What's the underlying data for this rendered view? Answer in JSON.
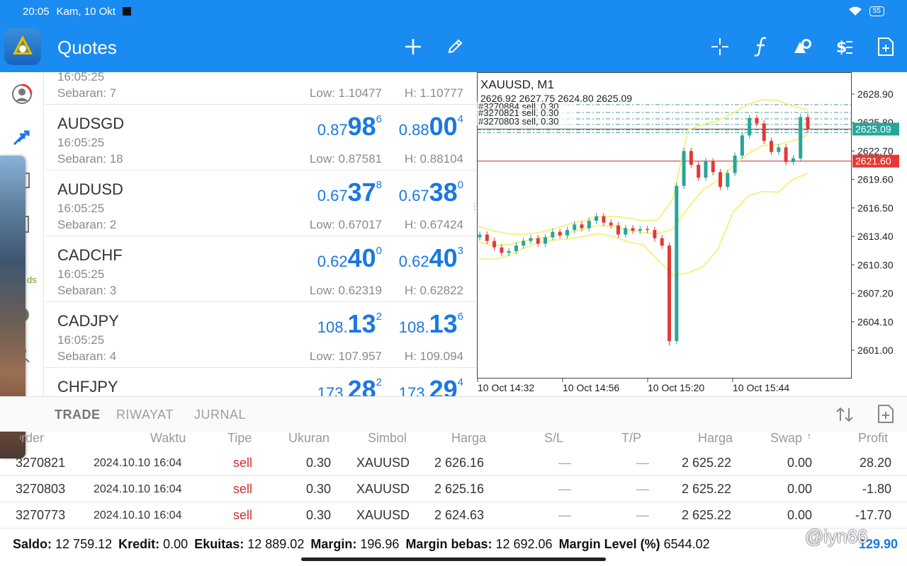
{
  "status": {
    "time": "20:05",
    "date": "Kam, 10 Okt",
    "battery": "55"
  },
  "header": {
    "title": "Quotes"
  },
  "quotes": {
    "top_time": "16:05:25",
    "top_spread": "Sebaran: 7",
    "top_low": "Low: 1.10477",
    "top_high": "H: 1.10777",
    "rows": [
      {
        "symbol": "AUDSGD",
        "time": "16:05:25",
        "spread": "Sebaran: 18",
        "bid_a": "0.87",
        "bid_b": "98",
        "bid_c": "6",
        "ask_a": "0.88",
        "ask_b": "00",
        "ask_c": "4",
        "low": "Low: 0.87581",
        "high": "H: 0.88104"
      },
      {
        "symbol": "AUDUSD",
        "time": "16:05:25",
        "spread": "Sebaran: 2",
        "bid_a": "0.67",
        "bid_b": "37",
        "bid_c": "8",
        "ask_a": "0.67",
        "ask_b": "38",
        "ask_c": "0",
        "low": "Low: 0.67017",
        "high": "H: 0.67424"
      },
      {
        "symbol": "CADCHF",
        "time": "16:05:25",
        "spread": "Sebaran: 3",
        "bid_a": "0.62",
        "bid_b": "40",
        "bid_c": "0",
        "ask_a": "0.62",
        "ask_b": "40",
        "ask_c": "3",
        "low": "Low: 0.62319",
        "high": "H: 0.62822"
      },
      {
        "symbol": "CADJPY",
        "time": "16:05:25",
        "spread": "Sebaran: 4",
        "bid_a": "108.",
        "bid_b": "13",
        "bid_c": "2",
        "ask_a": "108.",
        "ask_b": "13",
        "ask_c": "6",
        "low": "Low: 107.957",
        "high": "H: 109.094"
      },
      {
        "symbol": "CHFJPY",
        "time": "",
        "spread": "",
        "bid_a": "173.",
        "bid_b": "28",
        "bid_c": "2",
        "ask_a": "173.",
        "ask_b": "29",
        "ask_c": "4",
        "low": "",
        "high": ""
      }
    ]
  },
  "chart": {
    "title": "XAUUSD, M1",
    "ohlc": "2626.92 2627.75 2624.80 2625.09",
    "order_labels": [
      "#3270884 sell, 0.30",
      "#3270821 sell, 0.30",
      "#3270803 sell, 0.30"
    ],
    "y_ticks": [
      "2628.90",
      "2625.80",
      "2622.70",
      "2619.60",
      "2616.50",
      "2613.40",
      "2610.30",
      "2607.20",
      "2604.10",
      "2601.00"
    ],
    "x_ticks": [
      "10 Oct 14:32",
      "10 Oct 14:56",
      "10 Oct 15:20",
      "10 Oct 15:44"
    ],
    "bid_label": "2625.09",
    "ask_label": "2621.60",
    "bid_color": "#26a69a",
    "ask_color": "#e53935"
  },
  "chart_data": {
    "type": "candlestick",
    "symbol": "XAUUSD",
    "timeframe": "M1",
    "x": [
      "10 Oct 14:32",
      "10 Oct 14:56",
      "10 Oct 15:20",
      "10 Oct 15:44"
    ],
    "ylim": [
      2601.0,
      2628.9
    ],
    "current_price": 2625.09,
    "ask_line": 2621.6,
    "ohlc_last": {
      "open": 2626.92,
      "high": 2627.75,
      "low": 2624.8,
      "close": 2625.09
    },
    "closes": [
      2613.6,
      2612.9,
      2612.2,
      2611.6,
      2611.8,
      2612.4,
      2612.9,
      2613.2,
      2612.6,
      2613.3,
      2613.9,
      2613.5,
      2614.1,
      2614.7,
      2614.3,
      2615.1,
      2615.6,
      2614.9,
      2614.6,
      2613.6,
      2614.3,
      2614.0,
      2614.2,
      2614.1,
      2613.2,
      2612.4,
      2602.0,
      2618.9,
      2622.7,
      2621.2,
      2619.8,
      2621.6,
      2620.4,
      2618.8,
      2620.3,
      2622.2,
      2624.4,
      2626.3,
      2625.7,
      2623.8,
      2622.6,
      2623.1,
      2621.5,
      2621.9,
      2626.4,
      2625.09
    ],
    "bollinger_upper": [
      2614.5,
      2614.0,
      2613.7,
      2613.6,
      2613.8,
      2614.2,
      2614.7,
      2615.1,
      2615.5,
      2615.6,
      2615.4,
      2615.1,
      2615.2,
      2617.5,
      2625.0,
      2625.6,
      2626.0,
      2626.8,
      2627.8,
      2628.3,
      2628.2,
      2627.6,
      2627.2
    ],
    "bollinger_middle": [
      2612.8,
      2612.4,
      2612.5,
      2612.9,
      2613.2,
      2613.4,
      2613.8,
      2614.2,
      2614.6,
      2614.5,
      2614.1,
      2613.8,
      2613.7,
      2614.2,
      2616.5,
      2618.5,
      2619.5,
      2621.0,
      2622.4,
      2623.3,
      2623.4,
      2623.8,
      2624.4
    ],
    "bollinger_lower": [
      2611.0,
      2610.9,
      2611.3,
      2612.1,
      2612.7,
      2613.0,
      2613.1,
      2613.4,
      2613.7,
      2613.4,
      2612.8,
      2612.5,
      2610.8,
      2609.2,
      2609.4,
      2610.1,
      2612.0,
      2616.0,
      2617.8,
      2618.3,
      2618.2,
      2619.6,
      2620.3
    ]
  },
  "trade": {
    "tabs": [
      "TRADE",
      "RIWAYAT",
      "JURNAL"
    ],
    "columns": [
      "Order",
      "Waktu",
      "Tipe",
      "Ukuran",
      "Simbol",
      "Harga",
      "S/L",
      "T/P",
      "Harga",
      "Swap",
      "Profit"
    ],
    "rows": [
      {
        "order": "3270821",
        "time": "2024.10.10 16:04",
        "type": "sell",
        "size": "0.30",
        "symbol": "XAUUSD",
        "price": "2 626.16",
        "sl": "—",
        "tp": "—",
        "cur": "2 625.22",
        "swap": "0.00",
        "profit": "28.20"
      },
      {
        "order": "3270803",
        "time": "2024.10.10 16:04",
        "type": "sell",
        "size": "0.30",
        "symbol": "XAUUSD",
        "price": "2 625.16",
        "sl": "—",
        "tp": "—",
        "cur": "2 625.22",
        "swap": "0.00",
        "profit": "-1.80"
      },
      {
        "order": "3270773",
        "time": "2024.10.10 16:04",
        "type": "sell",
        "size": "0.30",
        "symbol": "XAUUSD",
        "price": "2 624.63",
        "sl": "—",
        "tp": "—",
        "cur": "2 625.22",
        "swap": "0.00",
        "profit": "-17.70"
      }
    ],
    "summary": {
      "saldo_label": "Saldo:",
      "saldo": "12 759.12",
      "kredit_label": "Kredit:",
      "kredit": "0.00",
      "ekuitas_label": "Ekuitas:",
      "ekuitas": "12 889.02",
      "margin_label": "Margin:",
      "margin": "196.96",
      "free_label": "Margin bebas:",
      "free": "12 692.06",
      "level_label": "Margin Level (%)",
      "level": "6544.02",
      "total": "129.90"
    }
  },
  "watermark": "@iyn66"
}
